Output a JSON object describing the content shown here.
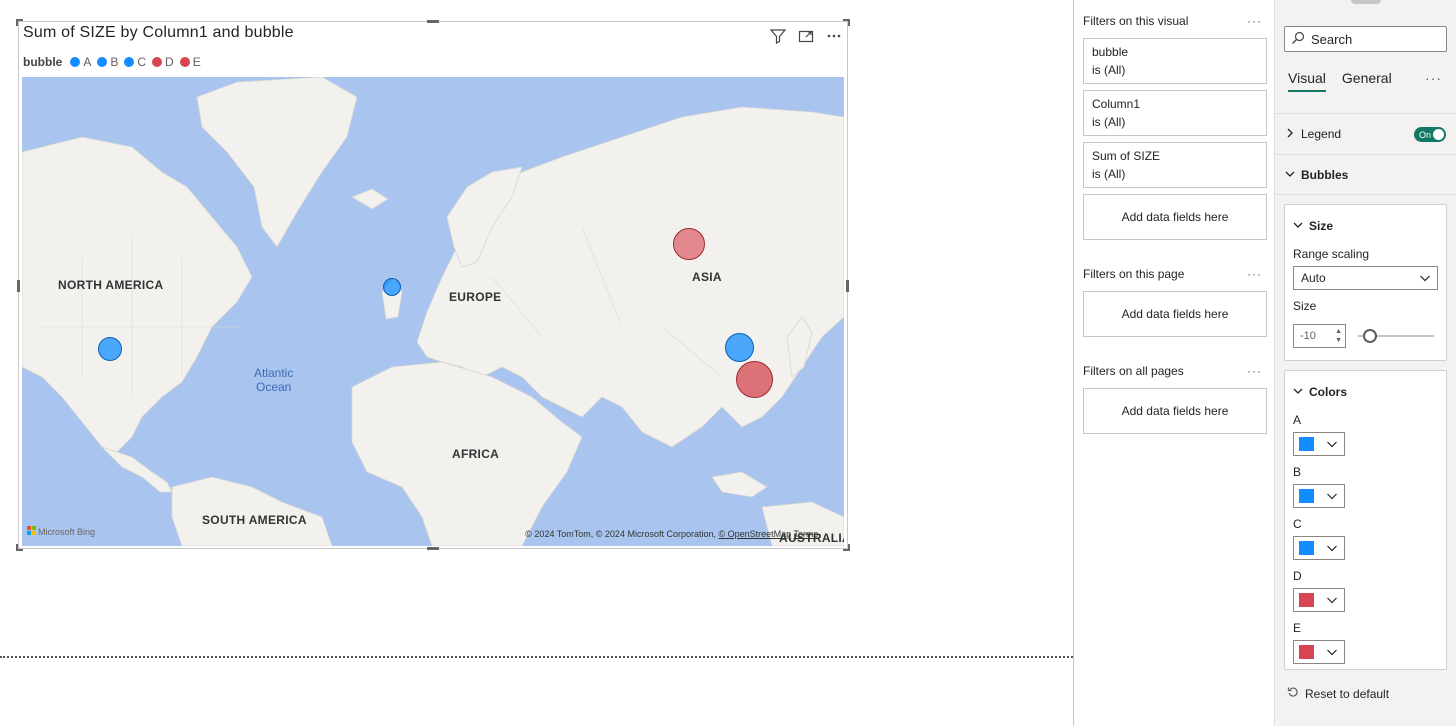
{
  "visual": {
    "title": "Sum of SIZE by Column1 and bubble",
    "legend_title": "bubble",
    "legend": [
      {
        "label": "A",
        "color": "#118DFF"
      },
      {
        "label": "B",
        "color": "#118DFF"
      },
      {
        "label": "C",
        "color": "#118DFF"
      },
      {
        "label": "D",
        "color": "#D64550"
      },
      {
        "label": "E",
        "color": "#D64550"
      }
    ],
    "icons": [
      "filter-icon",
      "focus-mode-icon",
      "more-options-icon"
    ]
  },
  "map": {
    "continents": [
      "NORTH AMERICA",
      "EUROPE",
      "ASIA",
      "AFRICA",
      "SOUTH AMERICA",
      "AUSTRALIA"
    ],
    "ocean": {
      "line1": "Atlantic",
      "line2": "Ocean"
    },
    "bing_logo": "Microsoft Bing",
    "copyright_text": "© 2024 TomTom, © 2024 Microsoft Corporation, ",
    "copyright_link": "© OpenStreetMap",
    "terms": "Terms",
    "bubble_colors": {
      "blue": "#118DFF",
      "red": "#D64550"
    }
  },
  "filters": {
    "visual_title": "Filters on this visual",
    "visual_cards": [
      {
        "name": "bubble",
        "state": "is (All)"
      },
      {
        "name": "Column1",
        "state": "is (All)"
      },
      {
        "name": "Sum of SIZE",
        "state": "is (All)"
      }
    ],
    "add_label": "Add data fields here",
    "page_title": "Filters on this page",
    "all_pages_title": "Filters on all pages",
    "more": "···"
  },
  "format": {
    "search_placeholder": "Search",
    "tabs": [
      "Visual",
      "General"
    ],
    "active_tab": "Visual",
    "more": "···",
    "legend_label": "Legend",
    "legend_toggle": "On",
    "bubbles_label": "Bubbles",
    "size_section": "Size",
    "range_scaling_label": "Range scaling",
    "range_scaling_value": "Auto",
    "size_label": "Size",
    "size_value": "-10",
    "colors_section": "Colors",
    "colors": [
      {
        "label": "A",
        "color": "#118DFF"
      },
      {
        "label": "B",
        "color": "#118DFF"
      },
      {
        "label": "C",
        "color": "#118DFF"
      },
      {
        "label": "D",
        "color": "#D64550"
      },
      {
        "label": "E",
        "color": "#D64550"
      }
    ],
    "reset_label": "Reset to default"
  }
}
